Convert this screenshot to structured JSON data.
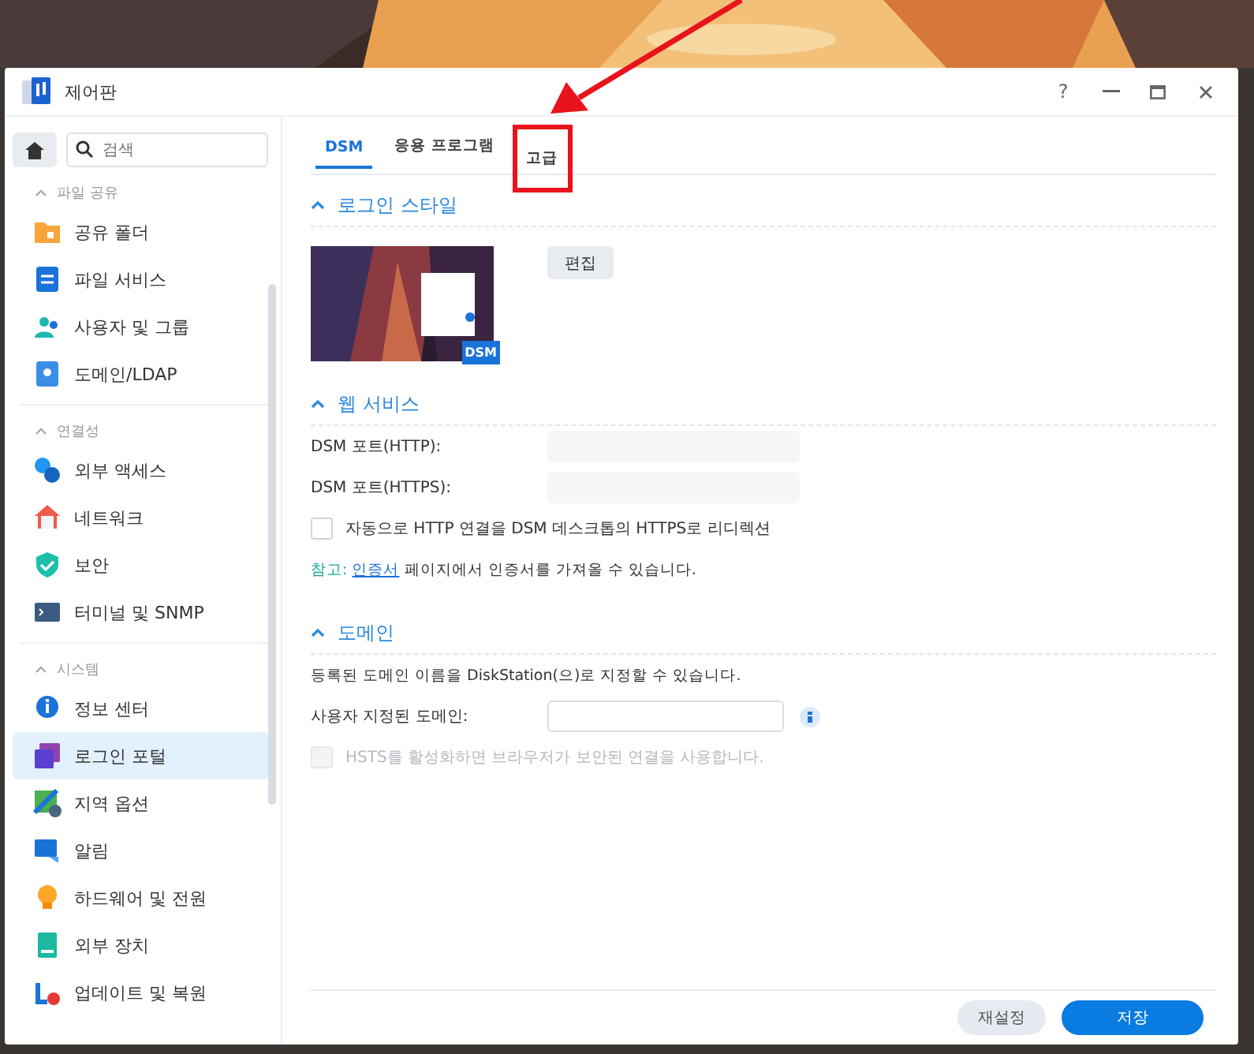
{
  "window": {
    "title": "제어판",
    "help_label": "?"
  },
  "sidebar": {
    "search": {
      "placeholder": "검색"
    },
    "groups": [
      {
        "title": "파일 공유",
        "expanded": true,
        "items": [
          {
            "label": "공유 폴더",
            "selected": false
          },
          {
            "label": "파일 서비스",
            "selected": false
          },
          {
            "label": "사용자 및 그룹",
            "selected": false
          },
          {
            "label": "도메인/LDAP",
            "selected": false
          }
        ]
      },
      {
        "title": "연결성",
        "expanded": true,
        "items": [
          {
            "label": "외부 액세스",
            "selected": false
          },
          {
            "label": "네트워크",
            "selected": false
          },
          {
            "label": "보안",
            "selected": false
          },
          {
            "label": "터미널 및 SNMP",
            "selected": false
          }
        ]
      },
      {
        "title": "시스템",
        "expanded": true,
        "items": [
          {
            "label": "정보 센터",
            "selected": false
          },
          {
            "label": "로그인 포털",
            "selected": true
          },
          {
            "label": "지역 옵션",
            "selected": false
          },
          {
            "label": "알림",
            "selected": false
          },
          {
            "label": "하드웨어 및 전원",
            "selected": false
          },
          {
            "label": "외부 장치",
            "selected": false
          },
          {
            "label": "업데이트 및 복원",
            "selected": false
          }
        ]
      }
    ]
  },
  "tabs": [
    {
      "label": "DSM",
      "selected": true,
      "highlighted": false
    },
    {
      "label": "응용 프로그램",
      "selected": false,
      "highlighted": false
    },
    {
      "label": "고급",
      "selected": false,
      "highlighted": true
    }
  ],
  "login_style": {
    "title": "로그인 스타일",
    "expanded": true,
    "preview_badge": "DSM",
    "edit_button": "편집"
  },
  "web_services": {
    "title": "웹 서비스",
    "expanded": true,
    "fields": [
      {
        "label": "DSM 포트(HTTP):"
      },
      {
        "label": "DSM 포트(HTTPS):"
      }
    ],
    "redirect": {
      "label": "자동으로 HTTP 연결을 DSM 데스크톱의 HTTPS로 리디렉션",
      "checked": false,
      "disabled": false
    },
    "note": {
      "prefix": "참고:",
      "link": "인증서",
      "text": "페이지에서 인증서를 가져올 수 있습니다."
    }
  },
  "domain": {
    "title": "도메인",
    "expanded": true,
    "description": "등록된 도메인 이름을 DiskStation(으)로 지정할 수 있습니다.",
    "field_label": "사용자 지정된 도메인:",
    "hsts": {
      "label": "HSTS를 활성화하면 브라우저가 보안된 연결을 사용합니다.",
      "checked": false,
      "disabled": true
    }
  },
  "footer": {
    "buttons": [
      {
        "label": "재설정",
        "kind": "secondary"
      },
      {
        "label": "저장",
        "kind": "primary"
      }
    ]
  }
}
